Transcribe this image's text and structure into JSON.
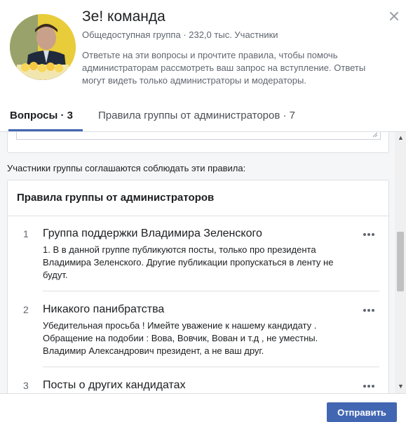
{
  "header": {
    "title": "Зе! команда",
    "meta": "Общедоступная группа · 232,0 тыс. Участники",
    "description": "Ответьте на эти вопросы и прочтите правила, чтобы помочь администраторам рассмотреть ваш запрос на вступление. Ответы могут видеть только администраторы и модераторы.",
    "close_icon": "close-icon"
  },
  "tabs": [
    {
      "label": "Вопросы · 3",
      "active": true
    },
    {
      "label": "Правила группы от администраторов · 7",
      "active": false
    }
  ],
  "agree_text": "Участники группы соглашаются соблюдать эти правила:",
  "rules_card": {
    "title": "Правила группы от администраторов",
    "rules": [
      {
        "number": "1",
        "title": "Группа поддержки Владимира Зеленского",
        "body": "1. В в данной группе публикуются посты, только про президента Владимира Зеленского. Другие публикации пропускаться в ленту не будут."
      },
      {
        "number": "2",
        "title": "Никакого панибратства",
        "body": "Убедительная просьба ! Имейте уважение к нашему кандидату . Обращение на подобии : Вова, Вовчик, Вован и т.д , не уместны. Владимир Александрович президент, а не ваш друг."
      },
      {
        "number": "3",
        "title": "Посты о других кандидатах",
        "body": ""
      }
    ]
  },
  "footer": {
    "submit_label": "Отправить"
  },
  "colors": {
    "accent": "#4267b2",
    "avatar_bg": "#e3c52f"
  }
}
